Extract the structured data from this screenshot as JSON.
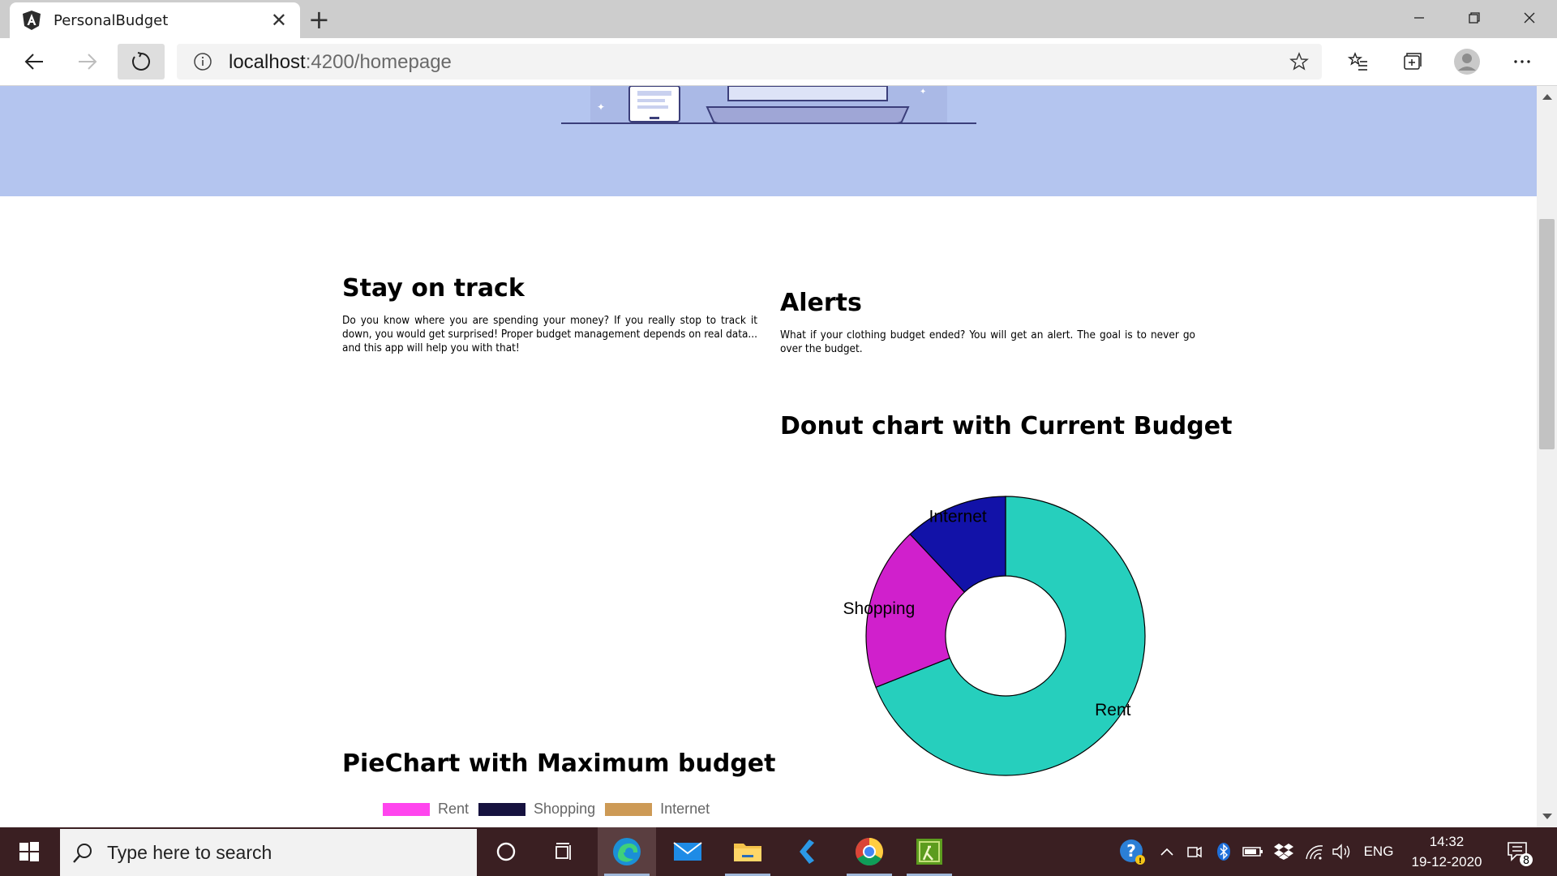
{
  "browser": {
    "tab_title": "PersonalBudget",
    "url_host": "localhost",
    "url_rest": ":4200/homepage"
  },
  "page": {
    "stay": {
      "title": "Stay on track",
      "text": "Do you know where you are spending your money? If you really stop to track it down, you would get surprised! Proper budget management depends on real data... and this app will help you with that!"
    },
    "alerts": {
      "title": "Alerts",
      "text": "What if your clothing budget ended? You will get an alert. The goal is to never go over the budget."
    },
    "donut_title": "Donut chart with Current Budget",
    "pie_title": "PieChart with Maximum budget"
  },
  "chart_data": [
    {
      "type": "pie",
      "title": "Donut chart with Current Budget",
      "donut": true,
      "categories": [
        "Rent",
        "Shopping",
        "Internet"
      ],
      "values": [
        69,
        19,
        12
      ],
      "colors": [
        "#26cfbd",
        "#d020cc",
        "#1212a8"
      ]
    },
    {
      "type": "pie",
      "title": "PieChart with Maximum budget",
      "legend": "top",
      "categories": [
        "Rent",
        "Shopping",
        "Internet"
      ],
      "colors": [
        "#ff45ee",
        "#16123f",
        "#cd9a56"
      ]
    }
  ],
  "taskbar": {
    "search_placeholder": "Type here to search",
    "language": "ENG",
    "time": "14:32",
    "date": "19-12-2020",
    "notification_count": "8"
  }
}
